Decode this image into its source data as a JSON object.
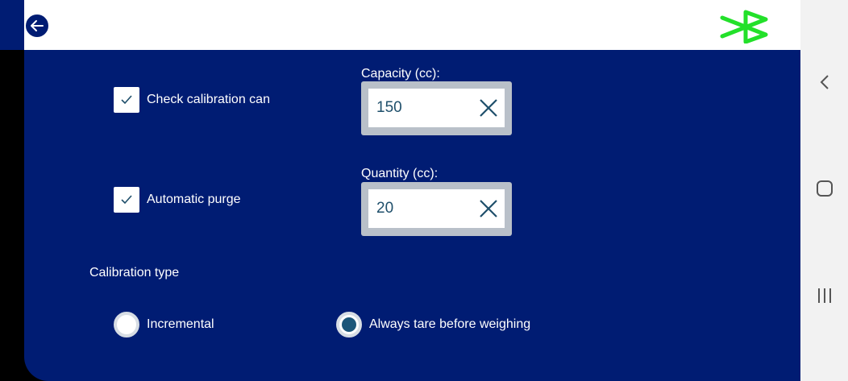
{
  "calibration": {
    "check_can": {
      "label": "Check calibration can",
      "checked": true
    },
    "auto_purge": {
      "label": "Automatic purge",
      "checked": true
    },
    "capacity": {
      "label": "Capacity (cc):",
      "value": "150"
    },
    "quantity": {
      "label": "Quantity (cc):",
      "value": "20"
    },
    "type_label": "Calibration type",
    "options": [
      {
        "label": "Incremental",
        "selected": false
      },
      {
        "label": "Always tare before weighing",
        "selected": true
      }
    ]
  },
  "icons": {
    "back": "back-arrow-icon",
    "bluetooth": "bluetooth-icon",
    "clear": "close-icon",
    "check": "checkmark-icon",
    "nav_back": "chevron-left-icon",
    "nav_home": "home-icon",
    "nav_recents": "recents-icon"
  },
  "colors": {
    "background": "#001c73",
    "bluetooth": "#23e02a",
    "input_text": "#1f4f6b",
    "radio_selected": "#1c5679"
  }
}
